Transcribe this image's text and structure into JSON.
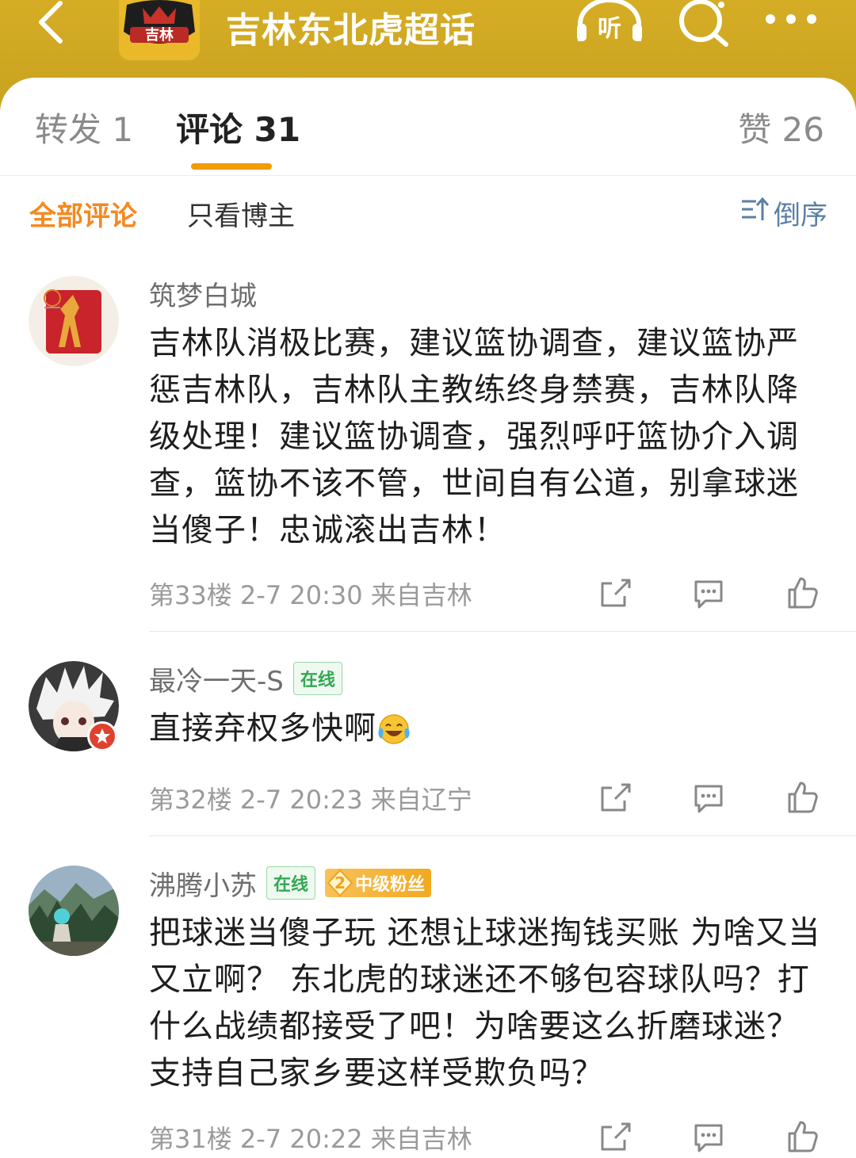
{
  "header": {
    "title": "吉林东北虎超话",
    "logo_text": "吉林",
    "listen_label": "听",
    "brand_color": "#c9a21f"
  },
  "tabs": [
    {
      "label": "转发 1"
    },
    {
      "label": "评论 31",
      "active": true
    },
    {
      "label": "赞 26"
    }
  ],
  "filters": {
    "all": "全部评论",
    "author_only": "只看博主",
    "sort": "倒序",
    "accent_color": "#f5891f"
  },
  "comments": [
    {
      "username": "筑梦白城",
      "badges": [],
      "text": "吉林队消极比赛，建议篮协调查，建议篮协严惩吉林队，吉林队主教练终身禁赛，吉林队降级处理！建议篮协调查，强烈呼吁篮协介入调查，篮协不该不管，世间自有公道，别拿球迷当傻子！忠诚滚出吉林！",
      "floor": "第33楼",
      "time": "2-7 20:30",
      "location": "来自吉林"
    },
    {
      "username": "最冷一天-S",
      "online": "在线",
      "text": "直接弃权多快啊",
      "emoji": "laughing-crying-emoji",
      "floor": "第32楼",
      "time": "2-7 20:23",
      "location": "来自辽宁"
    },
    {
      "username": "沸腾小苏",
      "online": "在线",
      "fan_level": "2",
      "fan_label": "中级粉丝",
      "text": "把球迷当傻子玩 还想让球迷掏钱买账 为啥又当又立啊？ 东北虎的球迷还不够包容球队吗？打什么战绩都接受了吧！为啥要这么折磨球迷？支持自己家乡要这样受欺负吗？",
      "floor": "第31楼",
      "time": "2-7 20:22",
      "location": "来自吉林"
    }
  ]
}
